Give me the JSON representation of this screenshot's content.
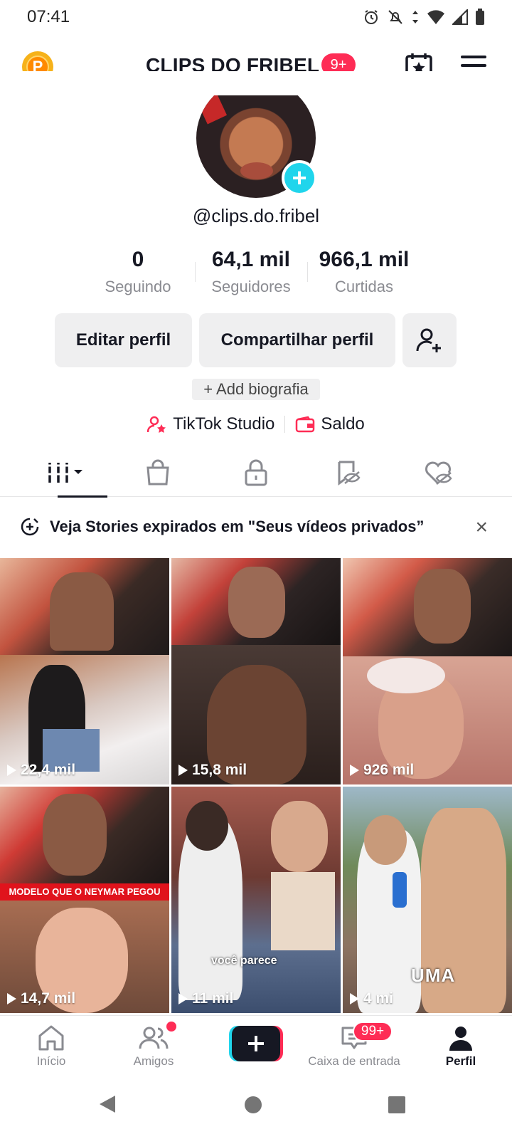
{
  "status_bar": {
    "time": "07:41"
  },
  "header": {
    "title": "CLIPS DO FRIBEL",
    "badge": "9+",
    "coin_letter": "P"
  },
  "profile": {
    "username": "@clips.do.fribel"
  },
  "stats": [
    {
      "value": "0",
      "label": "Seguindo"
    },
    {
      "value": "64,1 mil",
      "label": "Seguidores"
    },
    {
      "value": "966,1 mil",
      "label": "Curtidas"
    }
  ],
  "actions": {
    "edit": "Editar perfil",
    "share": "Compartilhar perfil",
    "bio": "+ Add biografia"
  },
  "links": {
    "studio": "TikTok Studio",
    "balance": "Saldo"
  },
  "colors": {
    "accent": "#fe2c55",
    "cyan": "#20d5ec",
    "text": "#161823",
    "muted": "#8a8b91"
  },
  "tabs": [
    "videos-icon",
    "shop-icon",
    "lock-icon",
    "reposts-icon",
    "liked-icon"
  ],
  "banner": {
    "text": "Veja Stories expirados em \"Seus vídeos privados”"
  },
  "videos": [
    {
      "views": "22,4 mil"
    },
    {
      "views": "15,8 mil"
    },
    {
      "views": "926 mil"
    },
    {
      "views": "14,7 mil",
      "caption": "MODELO QUE O NEYMAR PEGOU"
    },
    {
      "views": "11 mil",
      "caption": "você parece"
    },
    {
      "views": "4 mi",
      "caption": "UMA"
    }
  ],
  "bottom_nav": {
    "home": "Início",
    "friends": "Amigos",
    "inbox": "Caixa de entrada",
    "inbox_badge": "99+",
    "profile": "Perfil"
  }
}
